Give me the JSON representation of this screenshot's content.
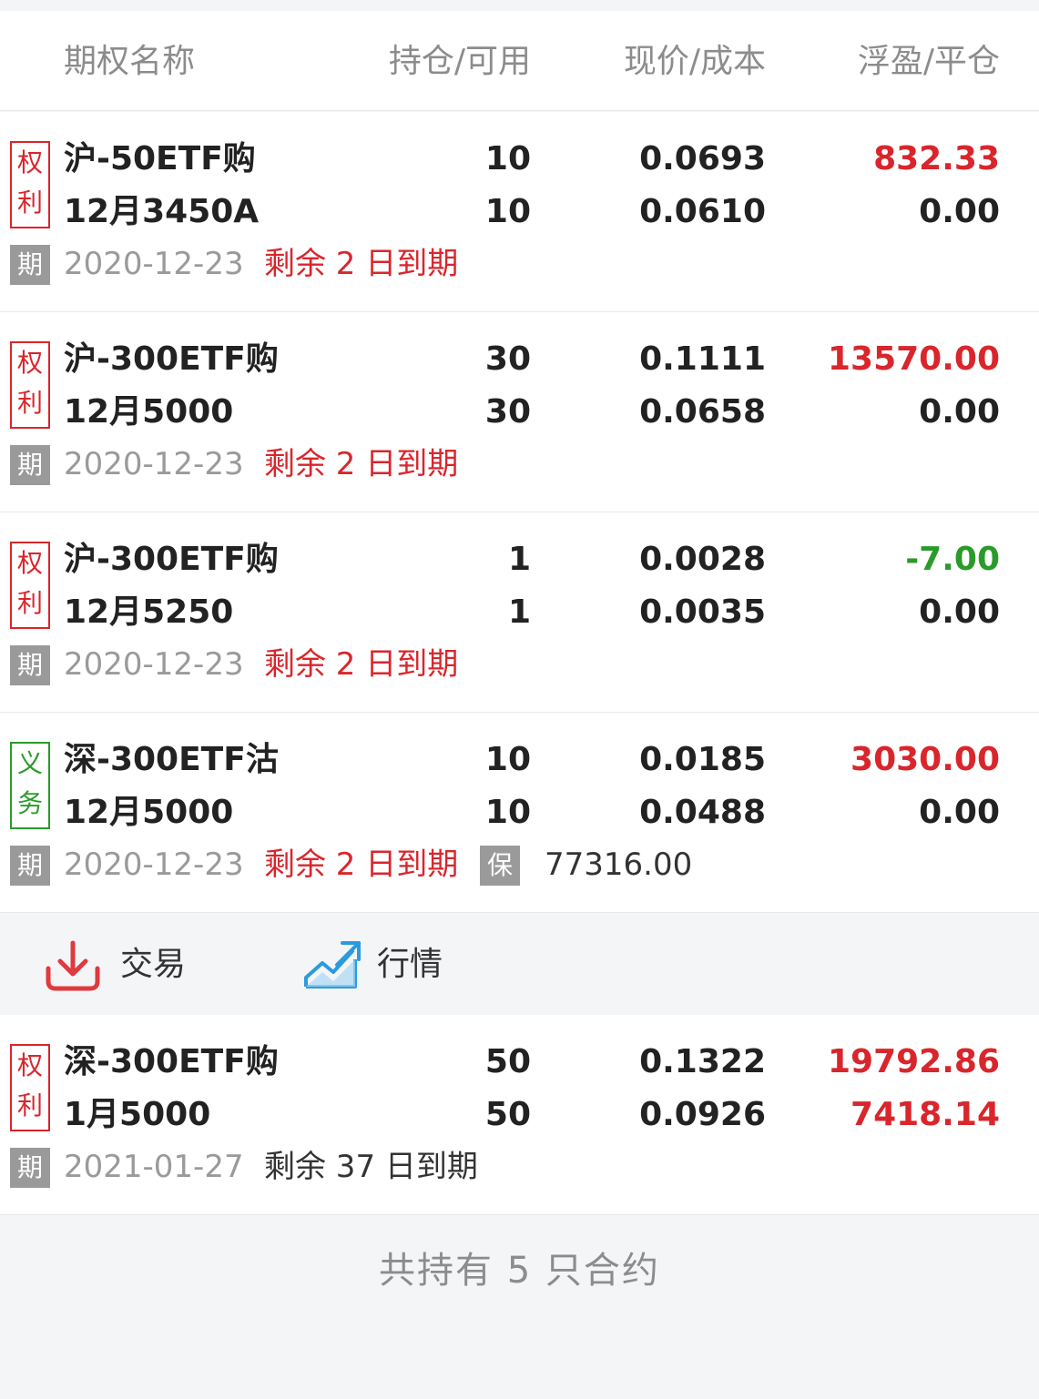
{
  "header": {
    "col_name": "期权名称",
    "col_position": "持仓/可用",
    "col_price": "现价/成本",
    "col_pnl": "浮盈/平仓"
  },
  "positions": [
    {
      "badge": "权利",
      "badge_chars": [
        "权",
        "利"
      ],
      "badge_color": "#d9262c",
      "name": "沪-50ETF购",
      "contract": "12月3450A",
      "holding": "10",
      "available": "10",
      "price": "0.0693",
      "cost": "0.0610",
      "floating_pnl": "832.33",
      "floating_pnl_color": "#d9262c",
      "close_pnl": "0.00",
      "expiry_tag": "期",
      "expiry_date": "2020-12-23",
      "remaining": "剩余 2 日到期"
    },
    {
      "badge": "权利",
      "badge_chars": [
        "权",
        "利"
      ],
      "badge_color": "#d9262c",
      "name": "沪-300ETF购",
      "contract": "12月5000",
      "holding": "30",
      "available": "30",
      "price": "0.1111",
      "cost": "0.0658",
      "floating_pnl": "13570.00",
      "floating_pnl_color": "#d9262c",
      "close_pnl": "0.00",
      "expiry_tag": "期",
      "expiry_date": "2020-12-23",
      "remaining": "剩余 2 日到期"
    },
    {
      "badge": "权利",
      "badge_chars": [
        "权",
        "利"
      ],
      "badge_color": "#d9262c",
      "name": "沪-300ETF购",
      "contract": "12月5250",
      "holding": "1",
      "available": "1",
      "price": "0.0028",
      "cost": "0.0035",
      "floating_pnl": "-7.00",
      "floating_pnl_color": "#2a9b2a",
      "close_pnl": "0.00",
      "expiry_tag": "期",
      "expiry_date": "2020-12-23",
      "remaining": "剩余 2 日到期"
    },
    {
      "badge": "义务",
      "badge_chars": [
        "义",
        "务"
      ],
      "badge_color": "#2a9b2a",
      "name": "深-300ETF沽",
      "contract": "12月5000",
      "holding": "10",
      "available": "10",
      "price": "0.0185",
      "cost": "0.0488",
      "floating_pnl": "3030.00",
      "floating_pnl_color": "#d9262c",
      "close_pnl": "0.00",
      "expiry_tag": "期",
      "expiry_date": "2020-12-23",
      "remaining": "剩余 2 日到期",
      "margin_tag": "保",
      "margin": "77316.00"
    },
    {
      "badge": "权利",
      "badge_chars": [
        "权",
        "利"
      ],
      "badge_color": "#d9262c",
      "name": "深-300ETF购",
      "contract": "1月5000",
      "holding": "50",
      "available": "50",
      "price": "0.1322",
      "cost": "0.0926",
      "floating_pnl": "19792.86",
      "floating_pnl_color": "#d9262c",
      "close_pnl": "7418.14",
      "close_pnl_color": "#d9262c",
      "expiry_tag": "期",
      "expiry_date": "2021-01-27",
      "remaining": "剩余 37 日到期"
    }
  ],
  "actions": {
    "trade_label": "交易",
    "trade_icon": "download-icon",
    "quote_label": "行情",
    "quote_icon": "trend-chart-icon"
  },
  "footer": {
    "summary": "共持有 5 只合约"
  },
  "colors": {
    "up": "#d9262c",
    "down": "#2a9b2a",
    "accent_blue": "#2b9be0"
  }
}
